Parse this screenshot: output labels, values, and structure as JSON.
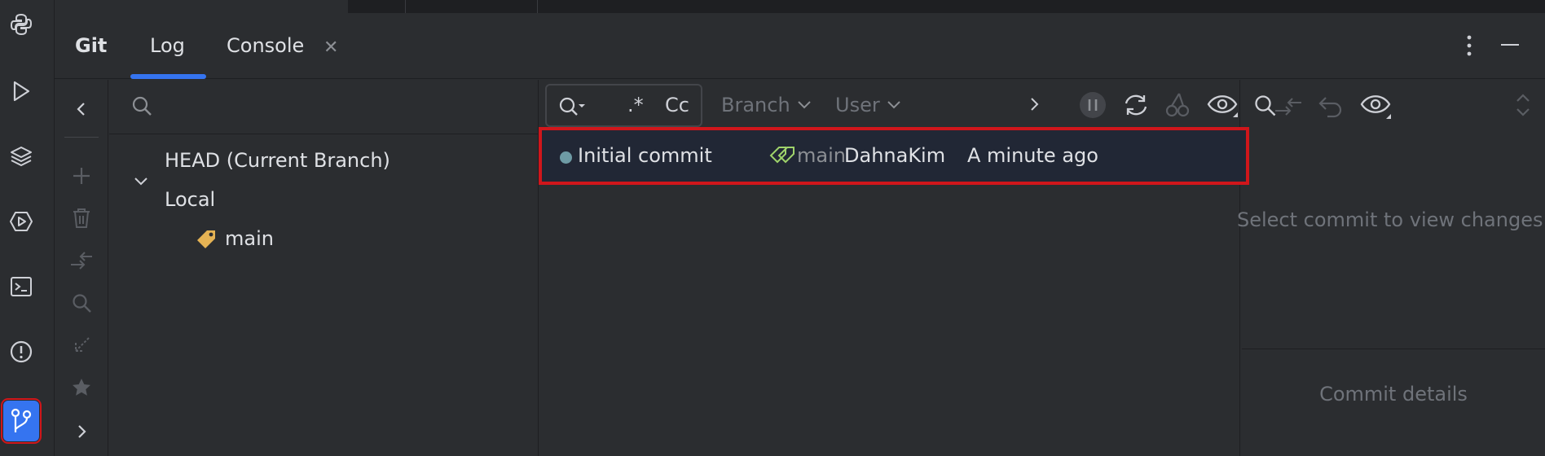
{
  "tool_window": {
    "title": "Git",
    "tabs": [
      {
        "label": "Log",
        "active": true
      },
      {
        "label": "Console",
        "closable": true
      }
    ]
  },
  "left_strip": {
    "icons": [
      "python-icon",
      "run-icon",
      "layers-icon",
      "services-icon",
      "terminal-icon",
      "problems-icon",
      "git-icon"
    ],
    "active": "git-icon"
  },
  "branch_tree": {
    "items": [
      {
        "label": "HEAD (Current Branch)",
        "level": 0
      },
      {
        "label": "Local",
        "level": 0,
        "expanded": true
      },
      {
        "label": "main",
        "level": 1,
        "icon": "tag-icon"
      }
    ]
  },
  "log_toolbar": {
    "regex_label": ".*",
    "case_label": "Cc",
    "branch_label": "Branch",
    "user_label": "User"
  },
  "commits": [
    {
      "message": "Initial commit",
      "ref": "main",
      "author": "DahnaKim",
      "date": "A minute ago"
    }
  ],
  "details": {
    "placeholder": "Select commit to view changes",
    "commit_details_label": "Commit details"
  },
  "colors": {
    "accent": "#3574f0",
    "highlight": "#d0161b",
    "panel_bg": "#2b2d30",
    "commit_dot": "#6e9ba5"
  }
}
